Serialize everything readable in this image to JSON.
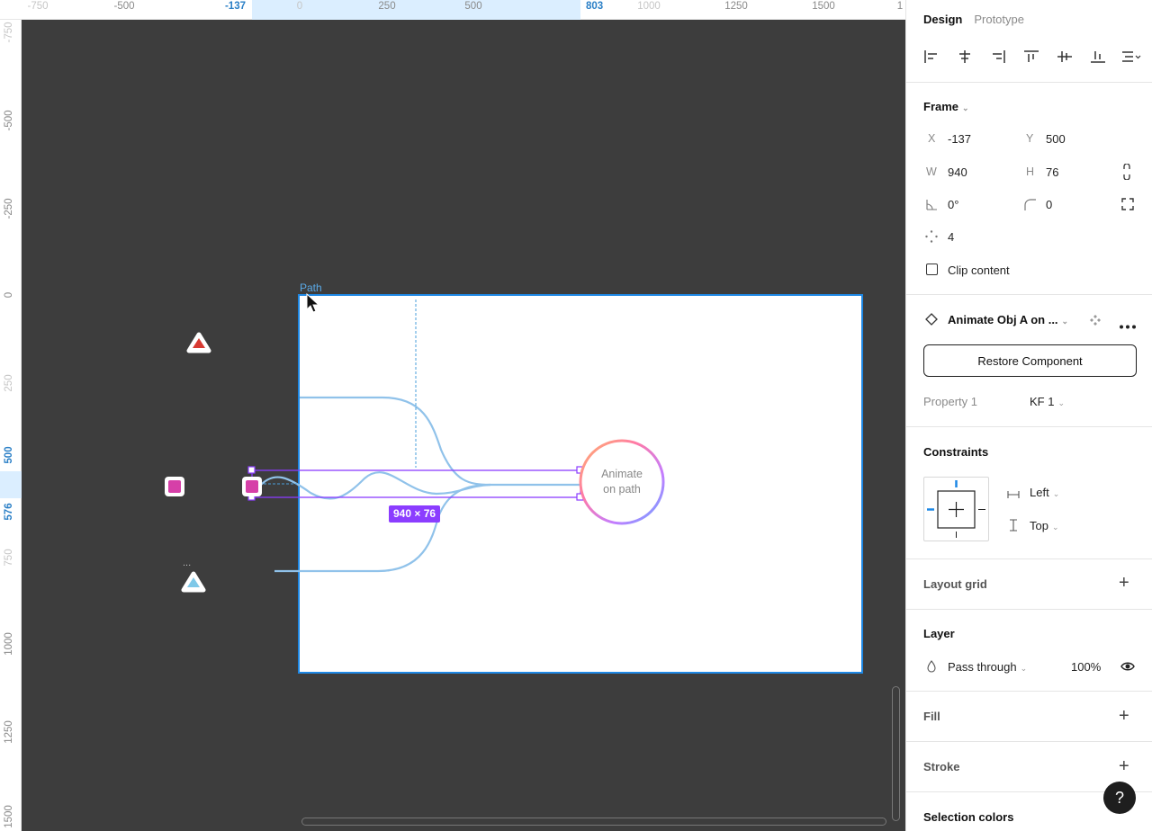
{
  "ruler_top": {
    "ticks": [
      "-750",
      "-500",
      "-137",
      "0",
      "250",
      "500",
      "803",
      "1000",
      "1250",
      "1500",
      "1"
    ]
  },
  "ruler_left": {
    "ticks": [
      "-750",
      "-500",
      "-250",
      "0",
      "250",
      "500",
      "576",
      "750",
      "1000",
      "1250",
      "1500"
    ]
  },
  "canvas": {
    "frame_label": "Path",
    "circle_label_line1": "Animate",
    "circle_label_line2": "on path",
    "dimension_badge": "940 × 76",
    "ellipsis": "..."
  },
  "panel": {
    "tabs": {
      "design": "Design",
      "prototype": "Prototype"
    },
    "frame": {
      "title": "Frame",
      "x_label": "X",
      "x_value": "-137",
      "y_label": "Y",
      "y_value": "500",
      "w_label": "W",
      "w_value": "940",
      "h_label": "H",
      "h_value": "76",
      "rotation": "0°",
      "radius": "0",
      "count": "4",
      "clip_content": "Clip content"
    },
    "component": {
      "name": "Animate Obj A on ...",
      "restore": "Restore Component",
      "property_label": "Property 1",
      "property_value": "KF 1"
    },
    "constraints": {
      "title": "Constraints",
      "horizontal": "Left",
      "vertical": "Top"
    },
    "layout_grid": "Layout grid",
    "layer": {
      "title": "Layer",
      "blend": "Pass through",
      "opacity": "100%"
    },
    "fill": "Fill",
    "stroke": "Stroke",
    "selection_colors": "Selection colors",
    "help": "?"
  },
  "colors": {
    "accent": "#1e88e5",
    "selection": "#8b3dff",
    "path": "#90c2ea",
    "canvas": "#3d3d3d"
  }
}
